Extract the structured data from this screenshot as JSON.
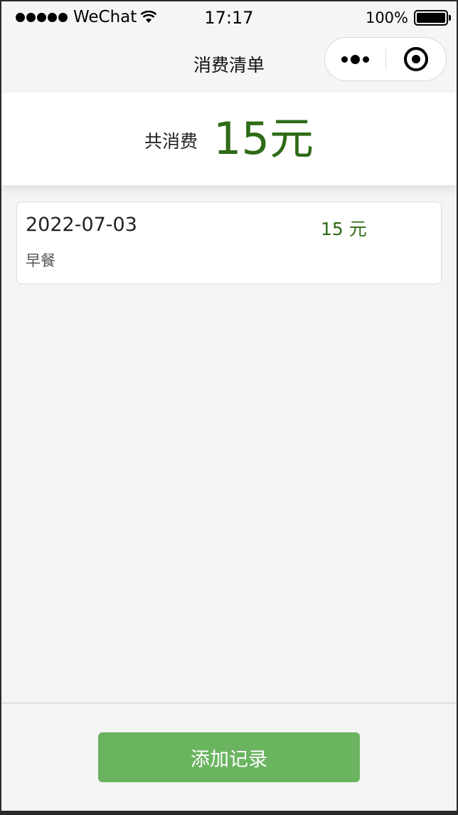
{
  "status_bar": {
    "carrier": "WeChat",
    "time": "17:17",
    "battery_percent": "100%"
  },
  "nav": {
    "title": "消费清单"
  },
  "summary": {
    "label": "共消费",
    "amount": "15元"
  },
  "records": [
    {
      "date": "2022-07-03",
      "amount": "15 元",
      "description": "早餐"
    }
  ],
  "actions": {
    "add_label": "添加记录"
  },
  "colors": {
    "accent_green": "#2e6b17",
    "button_green": "#6ab460",
    "background": "#f4f4f4"
  }
}
